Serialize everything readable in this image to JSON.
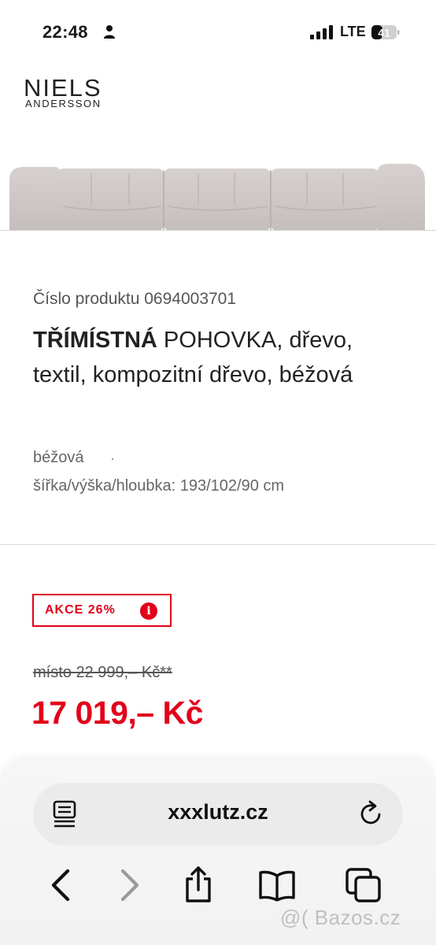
{
  "status_bar": {
    "time": "22:48",
    "network": "LTE",
    "battery": "41"
  },
  "brand": {
    "line1": "NIELS",
    "line2": "ANDERSSON"
  },
  "product": {
    "number_label": "Číslo produktu 0694003701",
    "title_bold": "TŘÍMÍSTNÁ",
    "title_rest": " POHOVKA, dřevo, textil, kompozitní dřevo, béžová",
    "color": "béžová",
    "separator": "·",
    "dimensions": "šířka/výška/hloubka: 193/102/90 cm"
  },
  "pricing": {
    "badge_label": "AKCE 26%",
    "info_glyph": "i",
    "old_price": "místo 22 999,– Kč**",
    "new_price": "17 019,– Kč"
  },
  "browser": {
    "url": "xxxlutz.cz"
  },
  "watermark": "@( Bazos.cz",
  "colors": {
    "accent": "#e2001a",
    "sofa": "#cbc5c3"
  },
  "icons": [
    "person-icon",
    "signal-icon",
    "battery-icon",
    "reader-icon",
    "reload-icon",
    "back-icon",
    "forward-icon",
    "share-icon",
    "bookmarks-icon",
    "tabs-icon",
    "info-icon"
  ]
}
